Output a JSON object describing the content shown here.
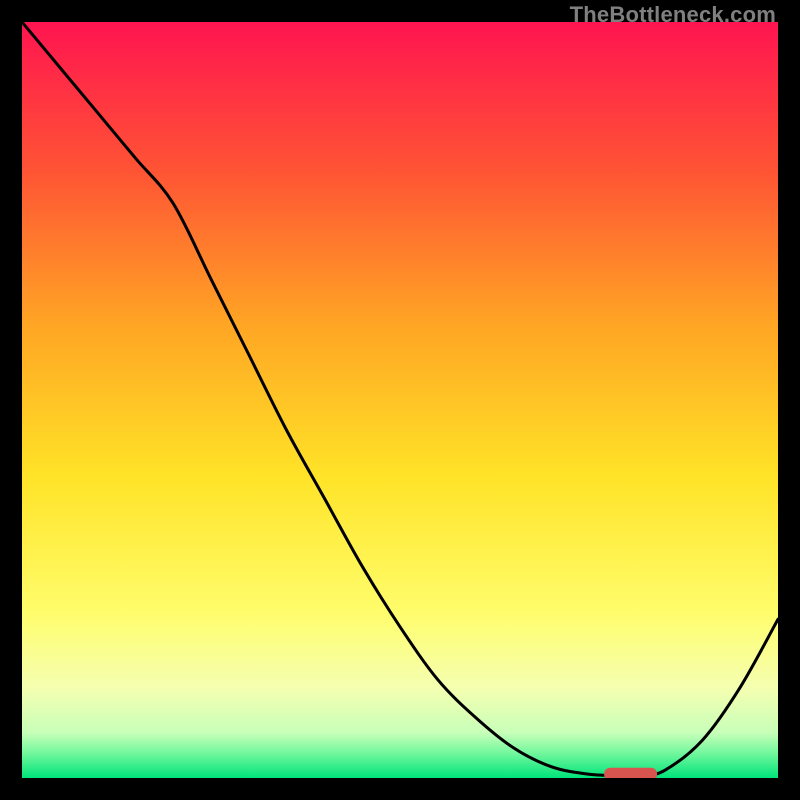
{
  "watermark": "TheBottleneck.com",
  "chart_data": {
    "type": "line",
    "title": "",
    "xlabel": "",
    "ylabel": "",
    "xlim": [
      0,
      100
    ],
    "ylim": [
      0,
      100
    ],
    "grid": false,
    "series": [
      {
        "name": "curve",
        "color": "#000000",
        "x": [
          0,
          5,
          10,
          15,
          20,
          25,
          30,
          35,
          40,
          45,
          50,
          55,
          60,
          65,
          70,
          75,
          80,
          82,
          85,
          90,
          95,
          100
        ],
        "y": [
          100,
          94,
          88,
          82,
          76,
          66,
          56,
          46,
          37,
          28,
          20,
          13,
          8,
          4,
          1.5,
          0.5,
          0.3,
          0.3,
          1,
          5,
          12,
          21
        ]
      }
    ],
    "marker": {
      "name": "minimum-marker",
      "x_range": [
        77,
        84
      ],
      "y": 0.5,
      "color": "#d9534f"
    },
    "gradient_stops": [
      {
        "offset": 0.0,
        "color": "#ff1450"
      },
      {
        "offset": 0.2,
        "color": "#ff5534"
      },
      {
        "offset": 0.4,
        "color": "#ffa524"
      },
      {
        "offset": 0.6,
        "color": "#ffe327"
      },
      {
        "offset": 0.78,
        "color": "#fffd6b"
      },
      {
        "offset": 0.88,
        "color": "#f5ffb0"
      },
      {
        "offset": 0.94,
        "color": "#c8ffb9"
      },
      {
        "offset": 0.965,
        "color": "#7af8a0"
      },
      {
        "offset": 1.0,
        "color": "#00e47a"
      }
    ]
  }
}
